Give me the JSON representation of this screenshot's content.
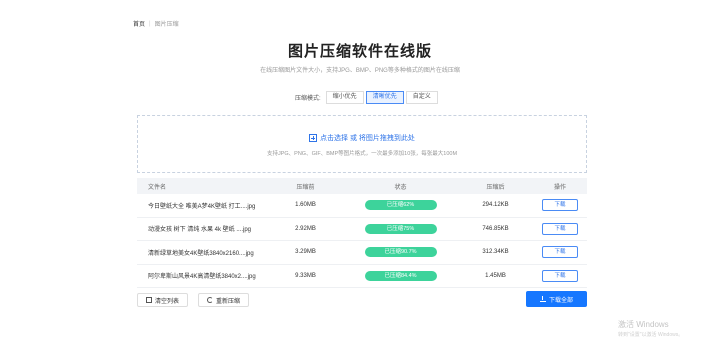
{
  "breadcrumb": {
    "home": "首页",
    "separator": "|",
    "current": "图片压缩"
  },
  "page": {
    "title": "图片压缩软件在线版",
    "subtitle": "在线压缩图片文件大小，支持JPG、BMP、PNG等多种格式的图片在线压缩"
  },
  "mode": {
    "label": "压缩模式:",
    "options": [
      "缩小优先",
      "清晰优先",
      "自定义"
    ],
    "selected": "清晰优先"
  },
  "upload": {
    "prompt": "点击选择 或 将图片拖拽到此处",
    "hint": "支持JPG、PNG、GIF、BMP等图片格式，一次最多添加10张，每张最大100M"
  },
  "table": {
    "headers": {
      "name": "文件名",
      "size": "压缩前",
      "status": "状态",
      "compressed": "压缩后",
      "action": "操作"
    },
    "rows": [
      {
        "name": "今日壁纸大全 唯美A梦4K壁纸 打工....jpg",
        "size": "1.60MB",
        "status": "已压缩62%",
        "compressed": "294.12KB",
        "action": "下载"
      },
      {
        "name": "动漫女孩 树下 清纯 水果 4k 壁纸 ....jpg",
        "size": "2.92MB",
        "status": "已压缩75%",
        "compressed": "746.85KB",
        "action": "下载"
      },
      {
        "name": "清新绿草地美女4K壁纸3840x2160....jpg",
        "size": "3.29MB",
        "status": "已压缩90.7%",
        "compressed": "312.34KB",
        "action": "下载"
      },
      {
        "name": "阿尔卑斯山风景4K高清壁纸3840x2....jpg",
        "size": "9.33MB",
        "status": "已压缩84.4%",
        "compressed": "1.45MB",
        "action": "下载"
      }
    ]
  },
  "footer": {
    "clear": "清空列表",
    "recompress": "重新压缩",
    "download_all": "下载全部"
  },
  "watermark": {
    "line1": "激活 Windows",
    "line2": "转到\"设置\"以激活 Windows。"
  },
  "colors": {
    "accent": "#1677ff",
    "success": "#3dd39b"
  }
}
